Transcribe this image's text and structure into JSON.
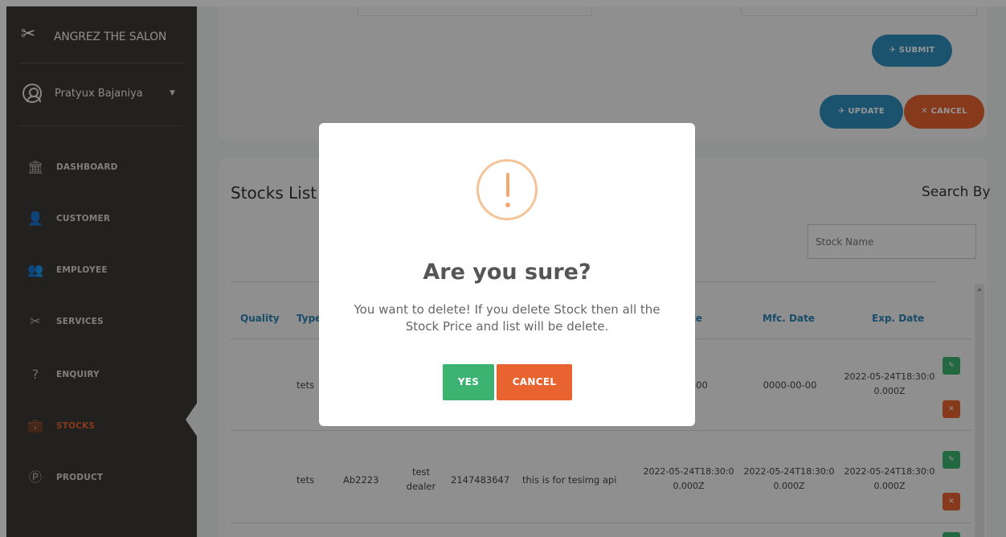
{
  "sidebar": {
    "brand": "ANGREZ THE SALON",
    "user": "Pratyux Bajaniya",
    "items": [
      {
        "label": "DASHBOARD",
        "icon": "bank-icon"
      },
      {
        "label": "CUSTOMER",
        "icon": "user-icon"
      },
      {
        "label": "EMPLOYEE",
        "icon": "users-icon"
      },
      {
        "label": "SERVICES",
        "icon": "scissors-icon"
      },
      {
        "label": "ENQUIRY",
        "icon": "question-icon"
      },
      {
        "label": "STOCKS",
        "icon": "briefcase-icon",
        "active": true
      },
      {
        "label": "PRODUCT",
        "icon": "p-circle-icon"
      }
    ]
  },
  "form": {
    "submit_label": "✈ SUBMIT",
    "update_label": "✈ UPDATE",
    "cancel_label": "✕ CANCEL"
  },
  "stocks": {
    "title": "Stocks List",
    "search_label": "Search By",
    "search_placeholder": "Stock Name",
    "headers": {
      "quality": "Quality",
      "type": "Type",
      "date_partial": "te",
      "mfc": "Mfc. Date",
      "exp": "Exp. Date"
    },
    "rows": [
      {
        "type": "tets",
        "date_partial": "-00",
        "mfc": "0000-00-00",
        "exp": "2022-05-24T18:30:00.000Z"
      },
      {
        "type": "tets",
        "code": "Ab2223",
        "dealer": "test dealer",
        "phone": "2147483647",
        "desc": "this is for tesimg api",
        "date": "2022-05-24T18:30:00.000Z",
        "mfc": "2022-05-24T18:30:00.000Z",
        "exp": "2022-05-24T18:30:00.000Z"
      }
    ]
  },
  "modal": {
    "title": "Are you sure?",
    "text": "You want to delete! If you delete Stock then all the Stock Price and list will be delete.",
    "yes_label": "YES",
    "cancel_label": "CANCEL"
  },
  "colors": {
    "sidebar_bg": "#3d3a37",
    "accent_orange": "#e8632f",
    "accent_blue": "#2c84b5",
    "accent_green": "#3cb371",
    "warning": "#f0a973"
  }
}
